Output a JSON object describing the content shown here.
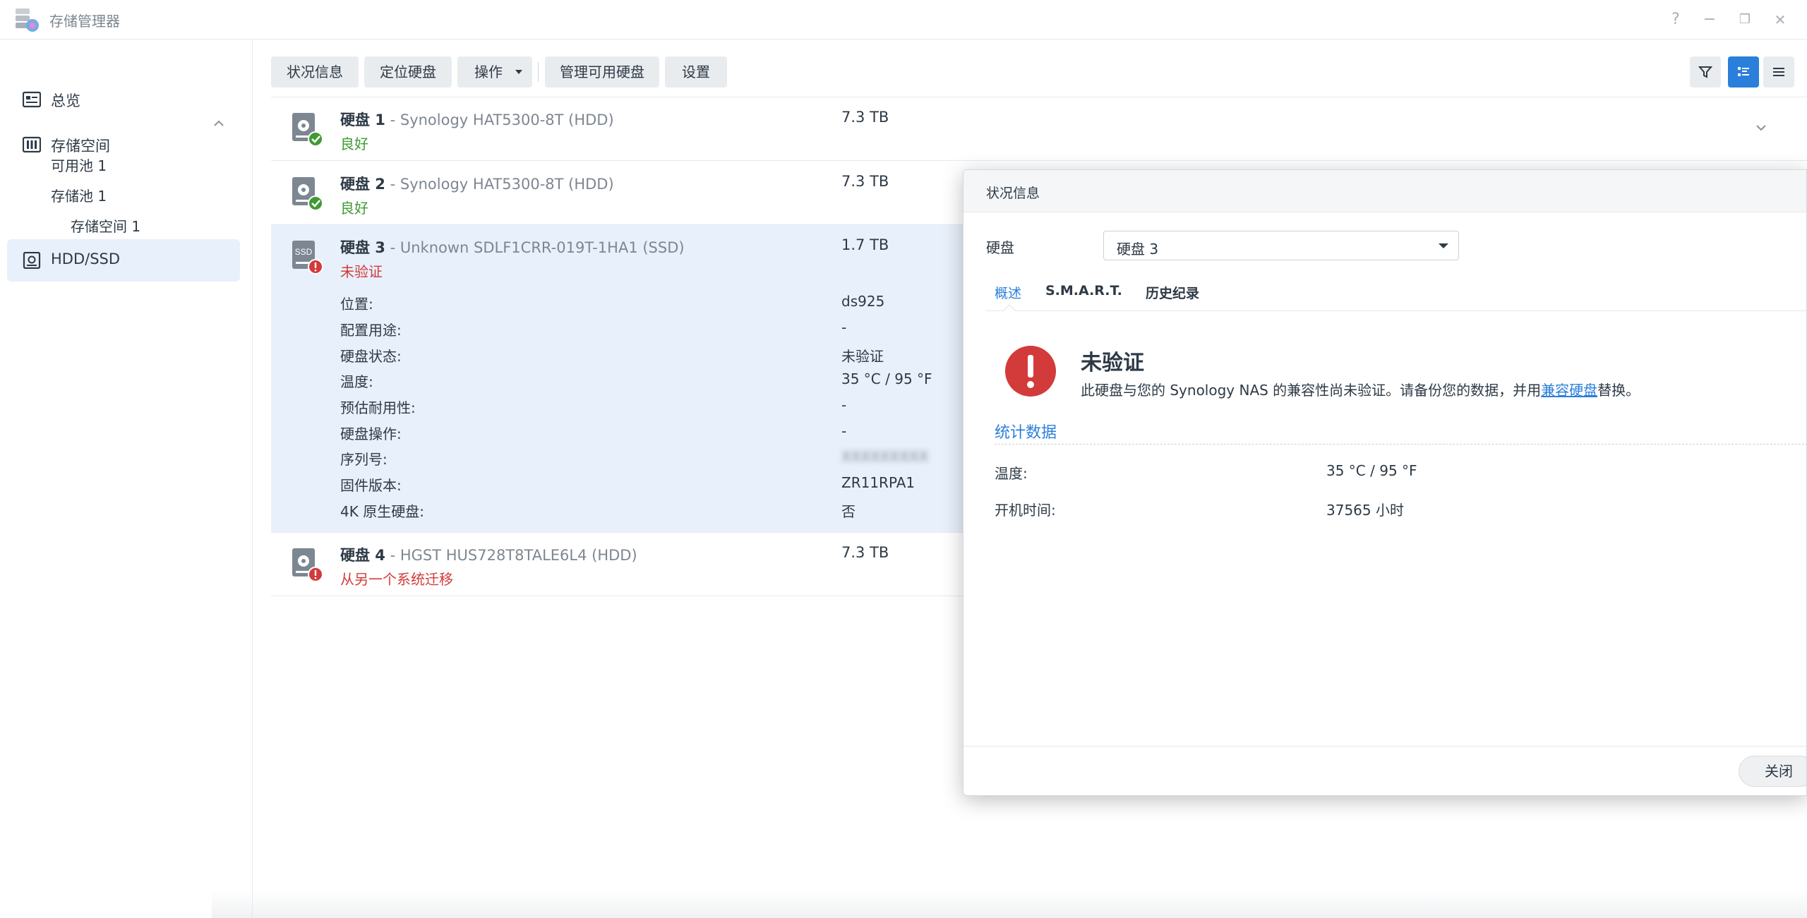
{
  "window": {
    "title": "存储管理器",
    "help": "?",
    "minimize": "−",
    "restore": "❐",
    "close": "✕"
  },
  "sidebar": {
    "items": [
      {
        "label": "总览",
        "icon": "overview-icon"
      },
      {
        "label": "存储空间",
        "icon": "storage-icon"
      },
      {
        "label": "HDD/SSD",
        "icon": "disk-icon"
      }
    ],
    "sub": [
      "可用池 1",
      "存储池 1",
      "存储空间 1"
    ]
  },
  "toolbar": {
    "status": "状况信息",
    "locate": "定位硬盘",
    "action": "操作",
    "manage_spare": "管理可用硬盘",
    "settings": "设置"
  },
  "disks": [
    {
      "label": "硬盘 1",
      "model": " - Synology HAT5300-8T (HDD)",
      "status": "良好",
      "size": "7.3 TB"
    },
    {
      "label": "硬盘 2",
      "model": " - Synology HAT5300-8T (HDD)",
      "status": "良好",
      "size": "7.3 TB"
    },
    {
      "label": "硬盘 3",
      "model": " - Unknown SDLF1CRR-019T-1HA1 (SSD)",
      "status": "未验证",
      "size": "1.7 TB"
    },
    {
      "label": "硬盘 4",
      "model": " - HGST HUS728T8TALE6L4 (HDD)",
      "status": "从另一个系统迁移",
      "size": "7.3 TB"
    }
  ],
  "disk3_details": [
    {
      "label": "位置:",
      "value": "ds925"
    },
    {
      "label": "配置用途:",
      "value": "-"
    },
    {
      "label": "硬盘状态:",
      "value": "未验证"
    },
    {
      "label": "温度:",
      "value": "35 °C / 95 °F"
    },
    {
      "label": "预估耐用性:",
      "value": "-"
    },
    {
      "label": "硬盘操作:",
      "value": "-"
    },
    {
      "label": "序列号:",
      "value": "XXXXXXXXX"
    },
    {
      "label": "固件版本:",
      "value": "ZR11RPA1"
    },
    {
      "label": "4K 原生硬盘:",
      "value": "否"
    }
  ],
  "icons": {
    "ssd_text": "SSD"
  },
  "dialog": {
    "title": "状况信息",
    "disk_label": "硬盘",
    "disk_selected": "硬盘 3",
    "tabs": [
      "概述",
      "S.M.A.R.T.",
      "历史纪录"
    ],
    "warn_title": "未验证",
    "warn_desc_pre": "此硬盘与您的 Synology NAS 的兼容性尚未验证。请备份您的数据，并用",
    "warn_link": "兼容硬盘",
    "warn_desc_post": "替换。",
    "section_title": "统计数据",
    "stats": [
      {
        "label": "温度:",
        "value": "35 °C / 95 °F"
      },
      {
        "label": "开机时间:",
        "value": "37565 小时"
      }
    ],
    "close": "关闭"
  },
  "colors": {
    "accent": "#2a7fdb",
    "ok": "#3f9a33",
    "error": "#d33a3a",
    "selected_row": "#e8f0fb"
  }
}
